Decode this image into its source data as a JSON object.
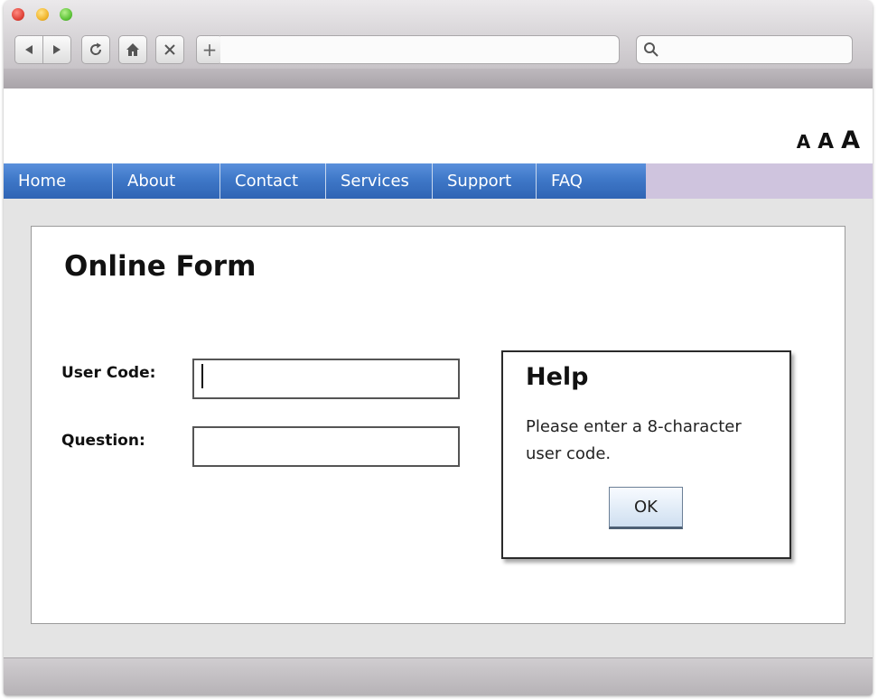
{
  "browser": {
    "icons": {
      "close": "close-dot-icon",
      "minimize": "minimize-dot-icon",
      "zoom": "zoom-dot-icon",
      "back": "arrow-left-icon",
      "forward": "arrow-right-icon",
      "reload": "reload-icon",
      "home": "home-icon",
      "stop": "close-icon",
      "search": "search-icon"
    },
    "new_tab_label": "+",
    "url_value": "",
    "search_value": ""
  },
  "text_size": {
    "small": "A",
    "medium": "A",
    "large": "A"
  },
  "menu": {
    "items": [
      {
        "label": "Home"
      },
      {
        "label": "About"
      },
      {
        "label": "Contact"
      },
      {
        "label": "Services"
      },
      {
        "label": "Support"
      },
      {
        "label": "FAQ"
      }
    ]
  },
  "form": {
    "title": "Online Form",
    "fields": [
      {
        "label": "User Code:",
        "value": ""
      },
      {
        "label": "Question:",
        "value": ""
      }
    ]
  },
  "help": {
    "title": "Help",
    "text": "Please enter a 8-character user code.",
    "ok_label": "OK"
  },
  "colors": {
    "menu_blue": "#3f78c8",
    "menu_bar_fill": "#cfc4de",
    "close_dot": "#e0443a",
    "minimize_dot": "#f2b62d",
    "zoom_dot": "#5fc43a"
  }
}
